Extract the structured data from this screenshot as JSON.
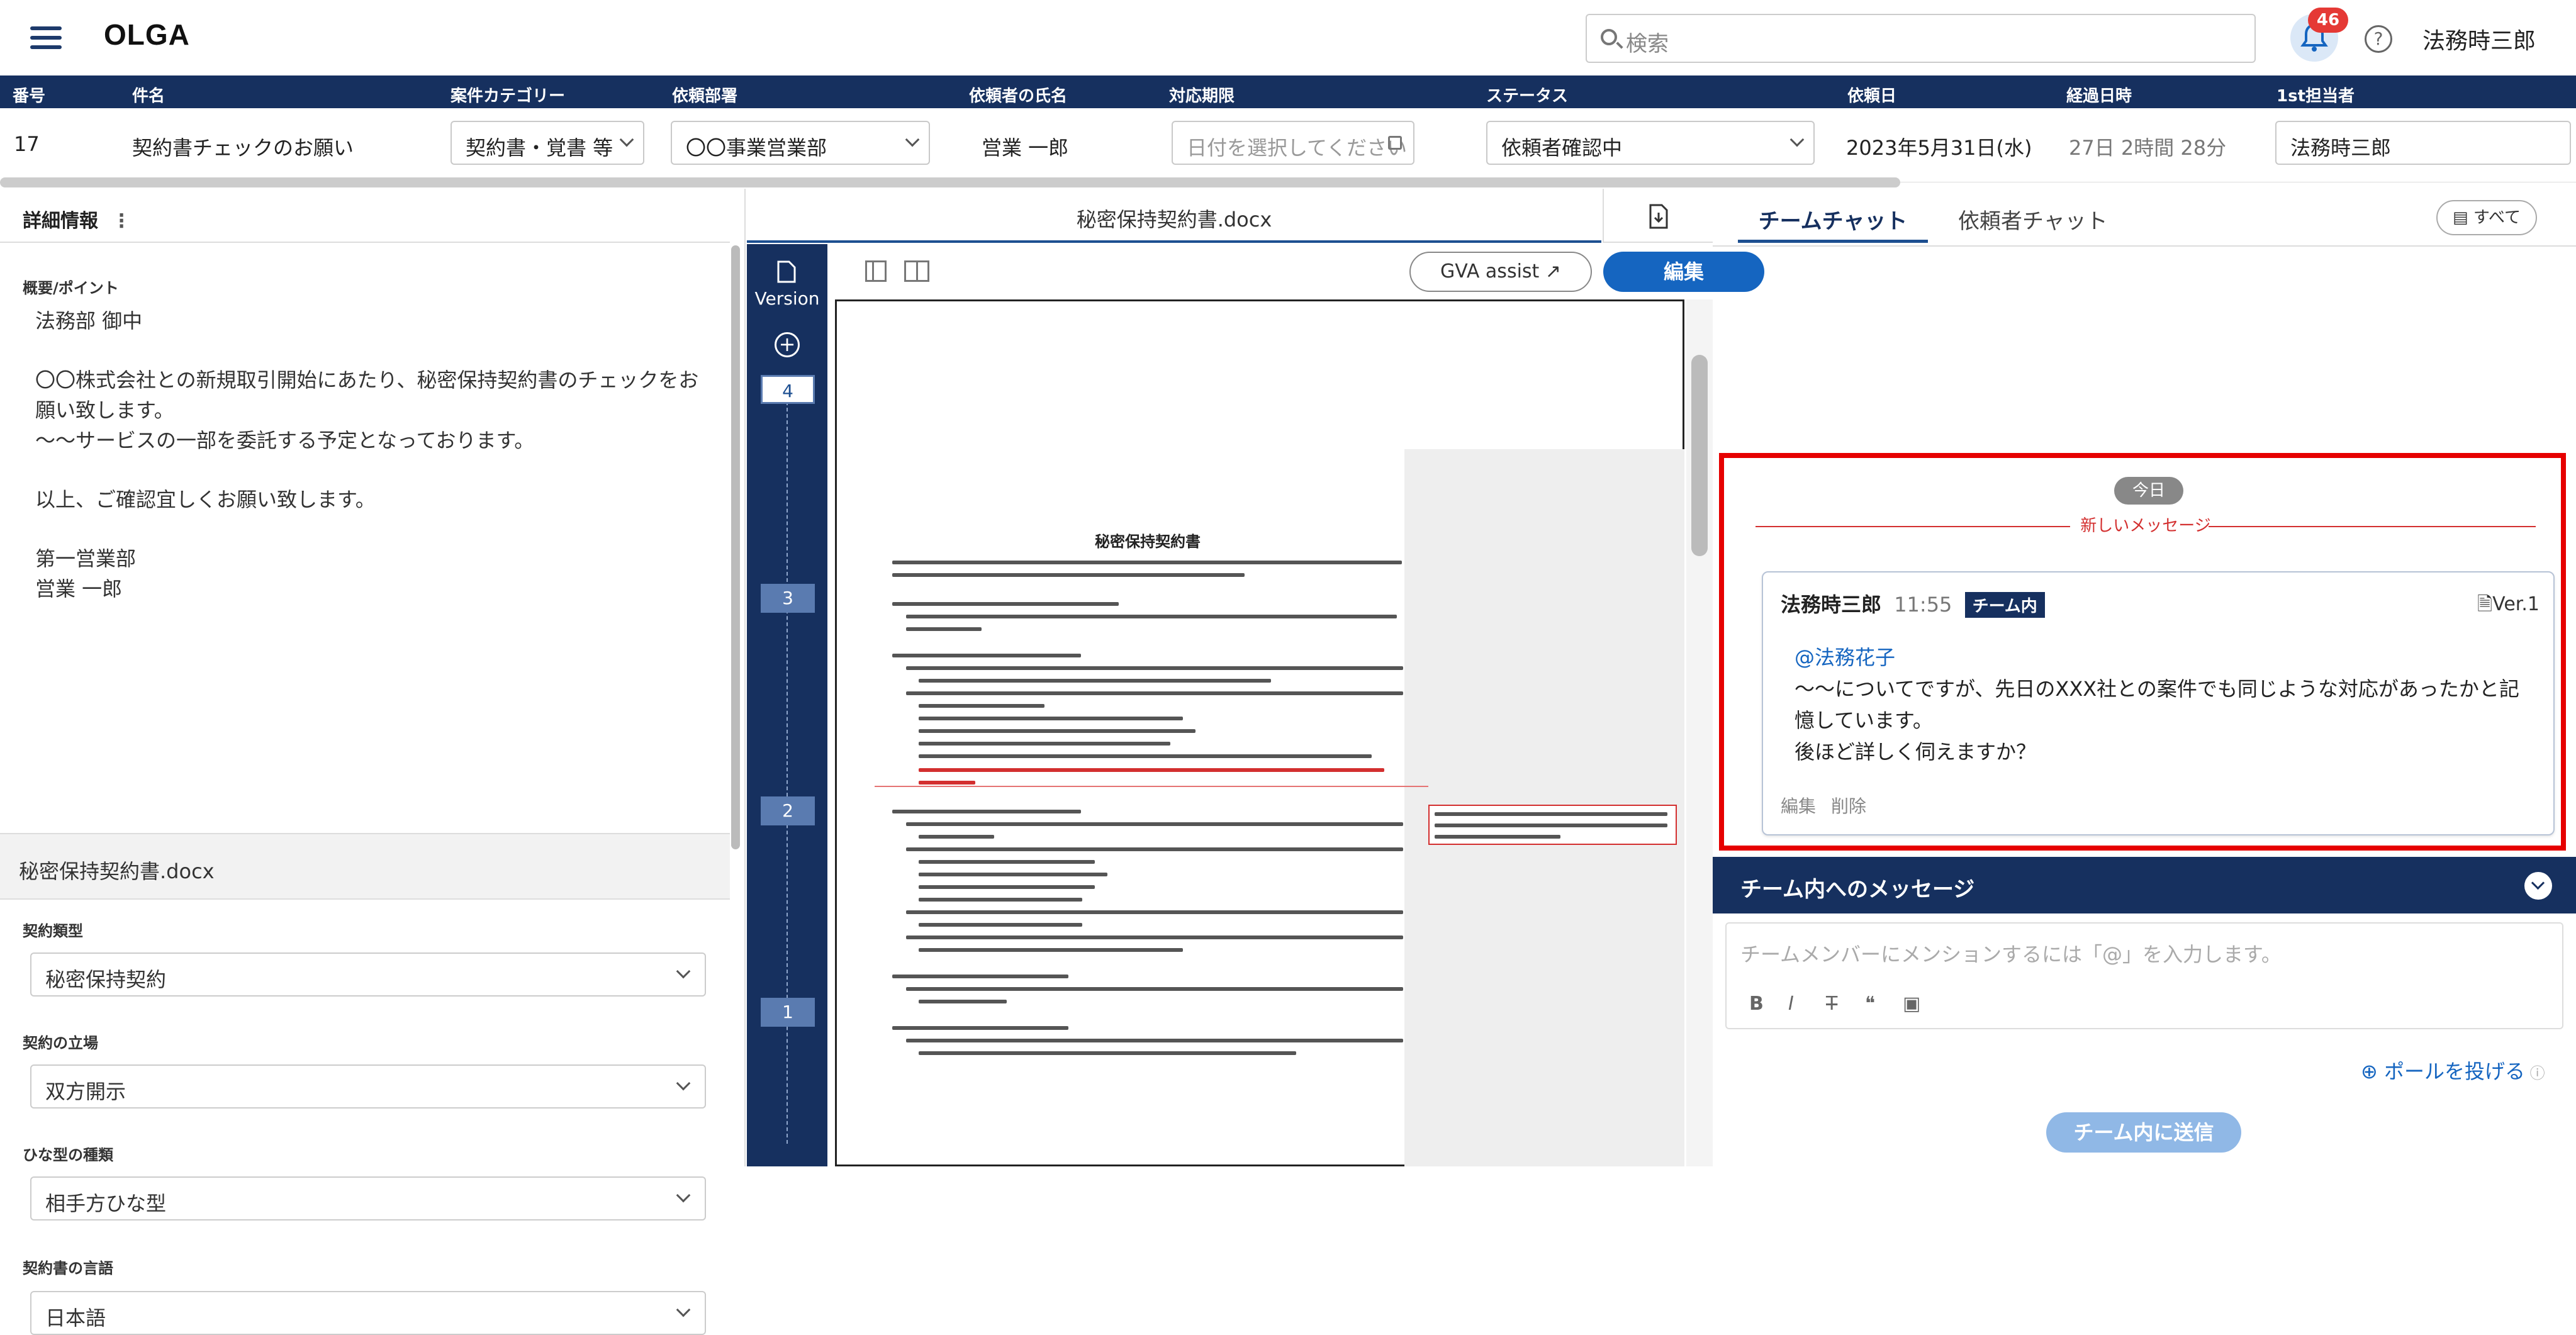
{
  "app": {
    "title": "OLGA",
    "search_placeholder": "検索",
    "notifications": "46",
    "user": "法務時三郎"
  },
  "table": {
    "headers": [
      "番号",
      "件名",
      "案件カテゴリー",
      "依頼部署",
      "依頼者の氏名",
      "対応期限",
      "ステータス",
      "依頼日",
      "経過日時",
      "1st担当者"
    ],
    "row": {
      "no": "17",
      "subject": "契約書チェックのお願い",
      "category": "契約書・覚書 等",
      "dept": "〇〇事業営業部",
      "requester": "営業 一郎",
      "deadline_placeholder": "日付を選択してください",
      "status": "依頼者確認中",
      "date": "2023年5月31日(水)",
      "elapsed": "27日 2時間 28分",
      "assignee": "法務時三郎"
    }
  },
  "left": {
    "header": "詳細情報",
    "summary_label": "概要/ポイント",
    "summary_lines": [
      "法務部 御中",
      "〇〇株式会社との新規取引開始にあたり、秘密保持契約書のチェックをお",
      "願い致します。",
      "〜〜サービスの一部を委託する予定となっております。",
      "以上、ご確認宜しくお願い致します。",
      "第一営業部",
      "営業 一郎"
    ],
    "doc_name": "秘密保持契約書.docx",
    "fields": [
      {
        "label": "契約類型",
        "value": "秘密保持契約"
      },
      {
        "label": "契約の立場",
        "value": "双方開示"
      },
      {
        "label": "ひな型の種類",
        "value": "相手方ひな型"
      },
      {
        "label": "契約書の言語",
        "value": "日本語"
      }
    ]
  },
  "viewer": {
    "tab": "秘密保持契約書.docx",
    "version_label": "Version",
    "versions": [
      "4",
      "3",
      "2",
      "1"
    ],
    "gva_label": "GVA assist",
    "edit_label": "編集",
    "doc_title": "秘密保持契約書"
  },
  "chat": {
    "tabs": [
      "チームチャット",
      "依頼者チャット"
    ],
    "all_label": "すべて",
    "today": "今日",
    "new_messages": "新しいメッセージ",
    "message": {
      "author": "法務時三郎",
      "time": "11:55",
      "chip": "チーム内",
      "version": "Ver.1",
      "mention": "@法務花子",
      "lines": [
        "〜〜についてですが、先日のXXX社との案件でも同じような対応があったかと記",
        "憶しています。",
        "後ほど詳しく伺えますか？"
      ],
      "edit": "編集",
      "delete": "削除"
    },
    "compose_title": "チーム内へのメッセージ",
    "compose_placeholder": "チームメンバーにメンションするには「@」を入力します。",
    "poll_label": "ポールを投げる",
    "send_label": "チーム内に送信"
  }
}
